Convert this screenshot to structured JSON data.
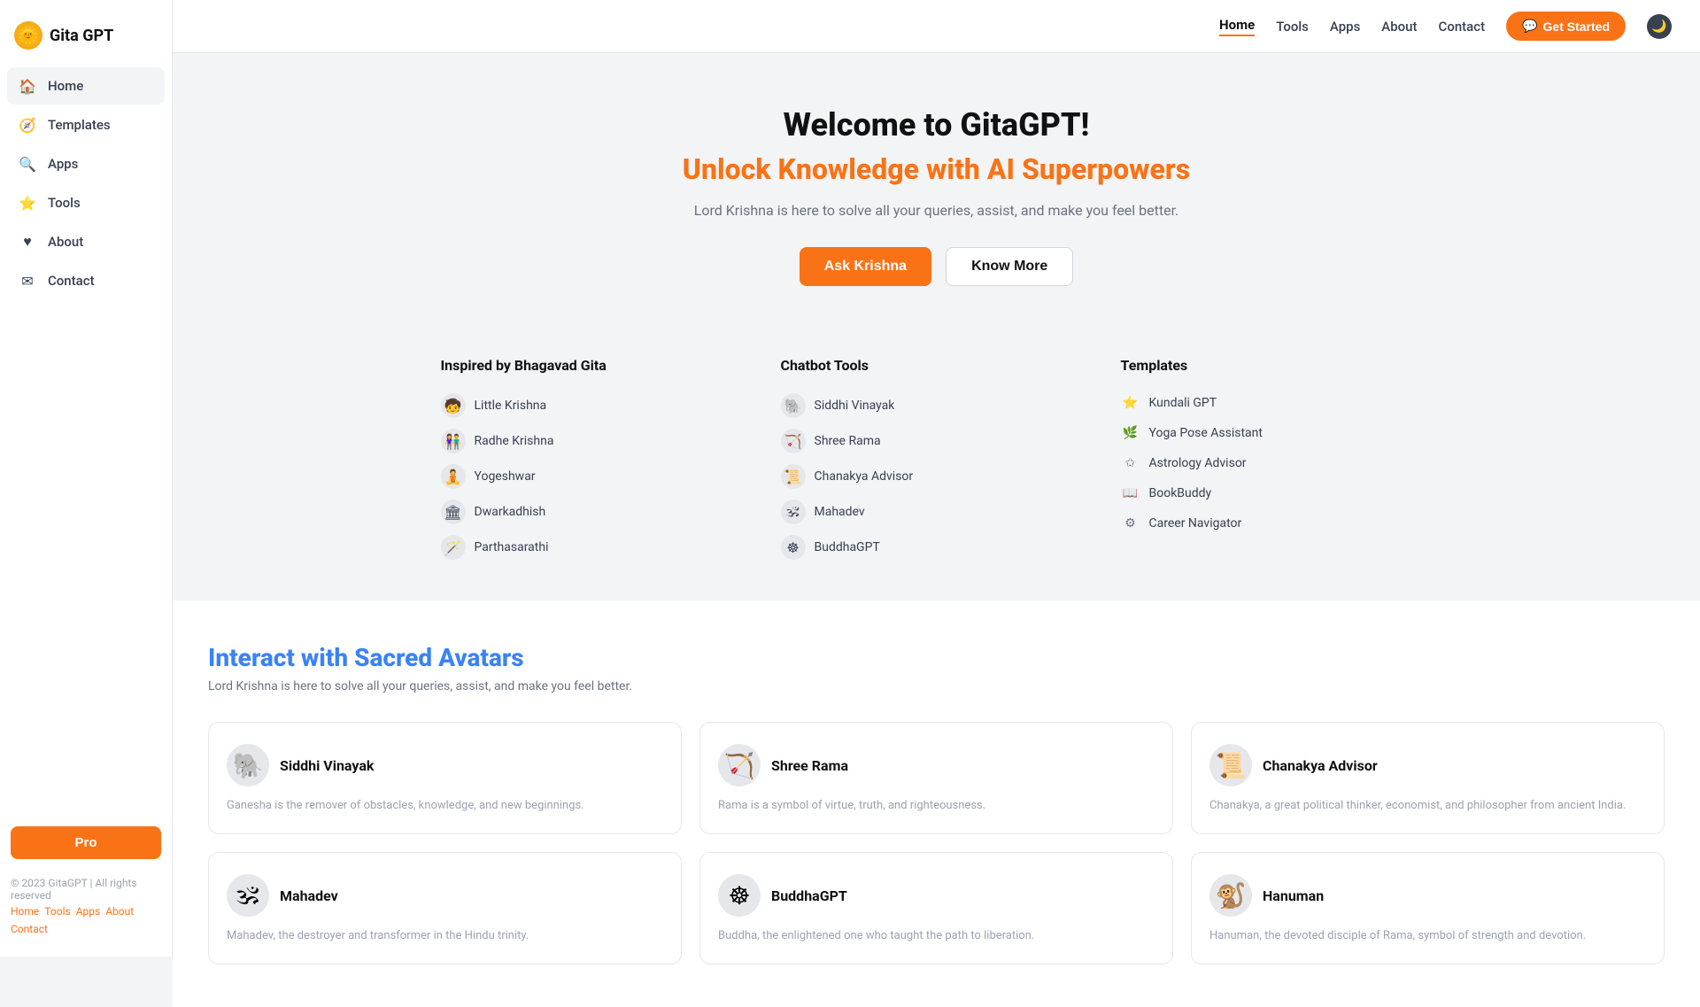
{
  "sidebar": {
    "logo": {
      "icon": "🌞",
      "text": "Gita GPT"
    },
    "nav_items": [
      {
        "id": "home",
        "label": "Home",
        "icon": "🏠",
        "active": true
      },
      {
        "id": "templates",
        "label": "Templates",
        "icon": "🧭"
      },
      {
        "id": "apps",
        "label": "Apps",
        "icon": "🔍"
      },
      {
        "id": "tools",
        "label": "Tools",
        "icon": "⭐"
      },
      {
        "id": "about",
        "label": "About",
        "icon": "♥"
      },
      {
        "id": "contact",
        "label": "Contact",
        "icon": "✉"
      }
    ],
    "pro_button_label": "Pro",
    "footer_text": "© 2023 GitaGPT | All rights reserved",
    "footer_links": [
      "Home",
      "Tools",
      "Apps",
      "About",
      "Contact"
    ]
  },
  "topnav": {
    "links": [
      "Home",
      "Tools",
      "Apps",
      "About",
      "Contact"
    ],
    "active_link": "Home",
    "get_started_label": "Get Started",
    "dark_mode_icon": "🌙"
  },
  "hero": {
    "title": "Welcome to GitaGPT!",
    "subtitle": "Unlock Knowledge with AI Superpowers",
    "desc": "Lord Krishna is here to solve all your queries, assist, and make you feel better.",
    "ask_button": "Ask Krishna",
    "know_button": "Know More"
  },
  "links_section": {
    "col1": {
      "title": "Inspired by Bhagavad Gita",
      "items": [
        {
          "label": "Little Krishna",
          "icon": "🧒"
        },
        {
          "label": "Radhe Krishna",
          "icon": "👫"
        },
        {
          "label": "Yogeshwar",
          "icon": "🧘"
        },
        {
          "label": "Dwarkadhish",
          "icon": "🏛"
        },
        {
          "label": "Parthasarathi",
          "icon": "🪄"
        }
      ]
    },
    "col2": {
      "title": "Chatbot Tools",
      "items": [
        {
          "label": "Siddhi Vinayak",
          "icon": "🐘"
        },
        {
          "label": "Shree Rama",
          "icon": "🏹"
        },
        {
          "label": "Chanakya Advisor",
          "icon": "📜"
        },
        {
          "label": "Mahadev",
          "icon": "🕉"
        },
        {
          "label": "BuddhaGPT",
          "icon": "☸"
        }
      ]
    },
    "col3": {
      "title": "Templates",
      "items": [
        {
          "label": "Kundali GPT",
          "icon": "⭐",
          "color": "#3b82f6"
        },
        {
          "label": "Yoga Pose Assistant",
          "icon": "🌿",
          "color": "#10b981"
        },
        {
          "label": "Astrology Advisor",
          "icon": "✩",
          "color": "#6b7280"
        },
        {
          "label": "BookBuddy",
          "icon": "📖",
          "color": "#6b7280"
        },
        {
          "label": "Career Navigator",
          "icon": "⚙",
          "color": "#6b7280"
        }
      ]
    }
  },
  "sacred_section": {
    "title_prefix": "Interact with ",
    "title_highlight": "Sacred Avatars",
    "desc": "Lord Krishna is here to solve all your queries, assist, and make you feel better.",
    "avatars": [
      {
        "name": "Siddhi Vinayak",
        "icon": "🐘",
        "desc": "Ganesha is the remover of obstacles, knowledge, and new beginnings."
      },
      {
        "name": "Shree Rama",
        "icon": "🏹",
        "desc": "Rama is a symbol of virtue, truth, and righteousness."
      },
      {
        "name": "Chanakya Advisor",
        "icon": "📜",
        "desc": "Chanakya, a great political thinker, economist, and philosopher from ancient India."
      },
      {
        "name": "Mahadev",
        "icon": "🕉",
        "desc": "Mahadev, the destroyer and transformer in the Hindu trinity."
      },
      {
        "name": "BuddhaGPT",
        "icon": "☸",
        "desc": "Buddha, the enlightened one who taught the path to liberation."
      },
      {
        "name": "Hanuman",
        "icon": "🐒",
        "desc": "Hanuman, the devoted disciple of Rama, symbol of strength and devotion."
      }
    ]
  }
}
